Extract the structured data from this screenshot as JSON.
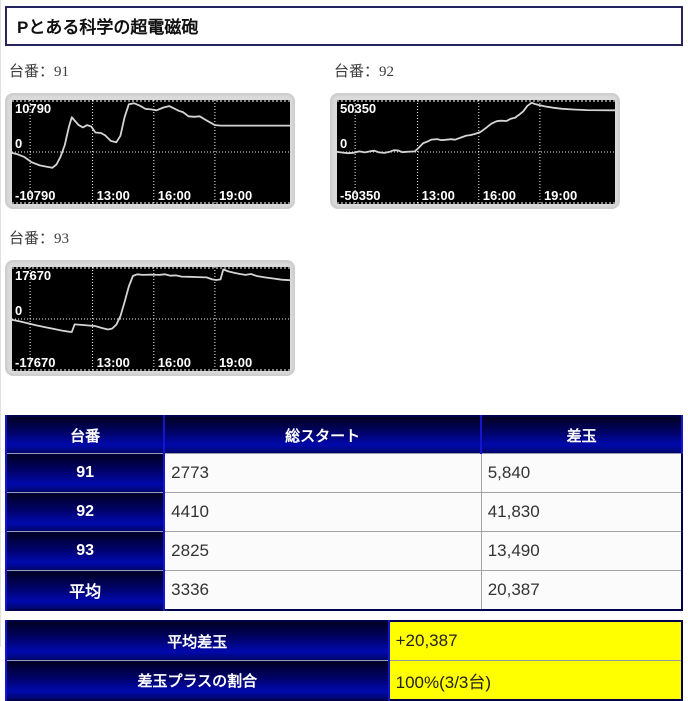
{
  "title": "Pとある科学の超電磁砲",
  "colors": {
    "navy_dark": "#000022",
    "navy_bright": "#0009ad",
    "blue_border": "#1515cc",
    "gray_border": "#a3a3a3",
    "highlight_yellow": "#ffff00",
    "chart_bg": "#000000",
    "chart_line": "#d4d4d4",
    "chart_frame": "#dadada"
  },
  "charts": [
    {
      "label": "台番：91",
      "y_max_label": "10790",
      "zero_label": "0",
      "y_min_label": "-10790",
      "ylim": 10790,
      "time_labels": [
        "13:00",
        "16:00",
        "19:00"
      ],
      "time_fracs": [
        0.29,
        0.51,
        0.73
      ],
      "extra_vline_frac": 0.065,
      "points": [
        [
          0.0,
          -200
        ],
        [
          0.02,
          -500
        ],
        [
          0.045,
          -1100
        ],
        [
          0.07,
          -2200
        ],
        [
          0.1,
          -2900
        ],
        [
          0.125,
          -3200
        ],
        [
          0.145,
          -3400
        ],
        [
          0.16,
          -2700
        ],
        [
          0.175,
          -1000
        ],
        [
          0.19,
          1500
        ],
        [
          0.205,
          5500
        ],
        [
          0.215,
          7500
        ],
        [
          0.225,
          6800
        ],
        [
          0.24,
          5800
        ],
        [
          0.255,
          5300
        ],
        [
          0.27,
          5800
        ],
        [
          0.285,
          5500
        ],
        [
          0.3,
          4200
        ],
        [
          0.32,
          4100
        ],
        [
          0.335,
          3600
        ],
        [
          0.355,
          2400
        ],
        [
          0.375,
          2100
        ],
        [
          0.39,
          3500
        ],
        [
          0.405,
          7500
        ],
        [
          0.42,
          10300
        ],
        [
          0.44,
          10500
        ],
        [
          0.46,
          10000
        ],
        [
          0.48,
          9300
        ],
        [
          0.5,
          9200
        ],
        [
          0.52,
          9000
        ],
        [
          0.545,
          9600
        ],
        [
          0.565,
          9900
        ],
        [
          0.58,
          9500
        ],
        [
          0.6,
          8900
        ],
        [
          0.615,
          8600
        ],
        [
          0.635,
          7700
        ],
        [
          0.655,
          7600
        ],
        [
          0.675,
          7700
        ],
        [
          0.695,
          7000
        ],
        [
          0.715,
          6300
        ],
        [
          0.73,
          5800
        ],
        [
          0.75,
          5700
        ],
        [
          0.8,
          5700
        ],
        [
          1.0,
          5700
        ]
      ]
    },
    {
      "label": "台番：92",
      "y_max_label": "50350",
      "zero_label": "0",
      "y_min_label": "-50350",
      "ylim": 50350,
      "time_labels": [
        "13:00",
        "16:00",
        "19:00"
      ],
      "time_fracs": [
        0.29,
        0.51,
        0.73
      ],
      "extra_vline_frac": 0.065,
      "points": [
        [
          0.0,
          200
        ],
        [
          0.02,
          -600
        ],
        [
          0.04,
          -1200
        ],
        [
          0.06,
          -800
        ],
        [
          0.08,
          600
        ],
        [
          0.1,
          -400
        ],
        [
          0.12,
          800
        ],
        [
          0.135,
          1300
        ],
        [
          0.15,
          -300
        ],
        [
          0.17,
          -900
        ],
        [
          0.19,
          300
        ],
        [
          0.205,
          1800
        ],
        [
          0.22,
          1500
        ],
        [
          0.235,
          -200
        ],
        [
          0.25,
          200
        ],
        [
          0.265,
          400
        ],
        [
          0.28,
          600
        ],
        [
          0.295,
          4500
        ],
        [
          0.31,
          9000
        ],
        [
          0.325,
          10500
        ],
        [
          0.34,
          12500
        ],
        [
          0.36,
          13000
        ],
        [
          0.375,
          12000
        ],
        [
          0.39,
          12300
        ],
        [
          0.41,
          12900
        ],
        [
          0.425,
          12400
        ],
        [
          0.445,
          14500
        ],
        [
          0.465,
          16500
        ],
        [
          0.48,
          17000
        ],
        [
          0.5,
          18500
        ],
        [
          0.515,
          20000
        ],
        [
          0.535,
          24000
        ],
        [
          0.555,
          28500
        ],
        [
          0.575,
          31000
        ],
        [
          0.59,
          31500
        ],
        [
          0.61,
          31200
        ],
        [
          0.625,
          33500
        ],
        [
          0.64,
          34500
        ],
        [
          0.655,
          37500
        ],
        [
          0.67,
          41000
        ],
        [
          0.685,
          46500
        ],
        [
          0.7,
          49500
        ],
        [
          0.715,
          48000
        ],
        [
          0.73,
          47000
        ],
        [
          0.75,
          45800
        ],
        [
          0.78,
          44500
        ],
        [
          0.81,
          43500
        ],
        [
          0.85,
          42800
        ],
        [
          0.9,
          42200
        ],
        [
          1.0,
          42000
        ]
      ]
    },
    {
      "label": "台番：93",
      "y_max_label": "17670",
      "zero_label": "0",
      "y_min_label": "-17670",
      "ylim": 17670,
      "time_labels": [
        "13:00",
        "16:00",
        "19:00"
      ],
      "time_fracs": [
        0.29,
        0.51,
        0.73
      ],
      "extra_vline_frac": 0.065,
      "points": [
        [
          0.0,
          -300
        ],
        [
          0.03,
          -900
        ],
        [
          0.06,
          -1600
        ],
        [
          0.09,
          -2300
        ],
        [
          0.12,
          -2900
        ],
        [
          0.15,
          -3500
        ],
        [
          0.18,
          -4100
        ],
        [
          0.205,
          -4500
        ],
        [
          0.215,
          -4600
        ],
        [
          0.225,
          -1900
        ],
        [
          0.25,
          -2100
        ],
        [
          0.275,
          -2300
        ],
        [
          0.3,
          -2500
        ],
        [
          0.325,
          -3200
        ],
        [
          0.345,
          -3700
        ],
        [
          0.36,
          -3400
        ],
        [
          0.375,
          -2000
        ],
        [
          0.39,
          1000
        ],
        [
          0.405,
          6000
        ],
        [
          0.42,
          11500
        ],
        [
          0.435,
          15200
        ],
        [
          0.45,
          15800
        ],
        [
          0.47,
          15600
        ],
        [
          0.5,
          15700
        ],
        [
          0.53,
          15600
        ],
        [
          0.55,
          15800
        ],
        [
          0.57,
          15300
        ],
        [
          0.59,
          15400
        ],
        [
          0.61,
          15000
        ],
        [
          0.64,
          14900
        ],
        [
          0.67,
          14800
        ],
        [
          0.7,
          14700
        ],
        [
          0.72,
          14000
        ],
        [
          0.735,
          13800
        ],
        [
          0.75,
          14000
        ],
        [
          0.76,
          17500
        ],
        [
          0.78,
          16800
        ],
        [
          0.8,
          16300
        ],
        [
          0.82,
          15900
        ],
        [
          0.84,
          15600
        ],
        [
          0.86,
          15900
        ],
        [
          0.88,
          15200
        ],
        [
          0.91,
          14700
        ],
        [
          0.94,
          14300
        ],
        [
          0.97,
          13900
        ],
        [
          1.0,
          13700
        ]
      ]
    }
  ],
  "table": {
    "headers": [
      "台番",
      "総スタート",
      "差玉"
    ],
    "rows": [
      {
        "machine": "91",
        "total_start": "2773",
        "diff": "5,840"
      },
      {
        "machine": "92",
        "total_start": "4410",
        "diff": "41,830"
      },
      {
        "machine": "93",
        "total_start": "2825",
        "diff": "13,490"
      },
      {
        "machine": "平均",
        "total_start": "3336",
        "diff": "20,387"
      }
    ]
  },
  "summary": {
    "rows": [
      {
        "label": "平均差玉",
        "value": "+20,387"
      },
      {
        "label": "差玉プラスの割合",
        "value": "100%(3/3台)"
      }
    ]
  }
}
